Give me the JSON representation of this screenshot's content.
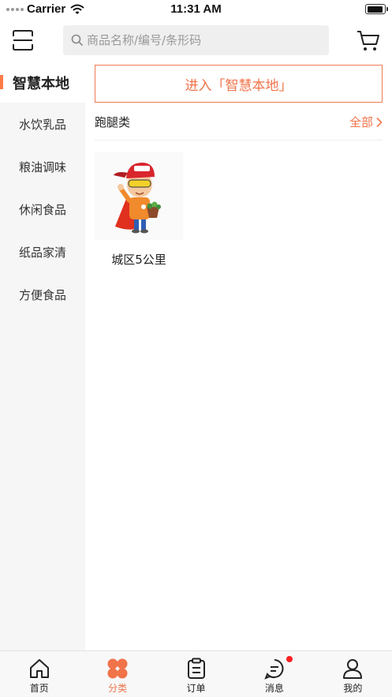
{
  "status_bar": {
    "carrier": "Carrier",
    "time": "11:31 AM"
  },
  "search": {
    "placeholder": "商品名称/编号/条形码"
  },
  "sidebar": {
    "active": "智慧本地",
    "items": [
      {
        "label": "水饮乳品"
      },
      {
        "label": "粮油调味"
      },
      {
        "label": "休闲食品"
      },
      {
        "label": "纸品家清"
      },
      {
        "label": "方便食品"
      }
    ]
  },
  "main": {
    "enter_button": "进入「智慧本地」",
    "section": {
      "title": "跑腿类",
      "all_label": "全部"
    },
    "products": [
      {
        "name": "城区5公里",
        "image_icon": "delivery-mascot"
      }
    ]
  },
  "tabs": [
    {
      "label": "首页",
      "icon": "home-icon"
    },
    {
      "label": "分类",
      "icon": "category-icon",
      "active": true
    },
    {
      "label": "订单",
      "icon": "order-icon"
    },
    {
      "label": "消息",
      "icon": "message-icon",
      "badge": true
    },
    {
      "label": "我的",
      "icon": "profile-icon"
    }
  ],
  "colors": {
    "accent": "#f0734a",
    "sidebar_bg": "#f6f6f6",
    "badge": "#ff1f1f"
  }
}
